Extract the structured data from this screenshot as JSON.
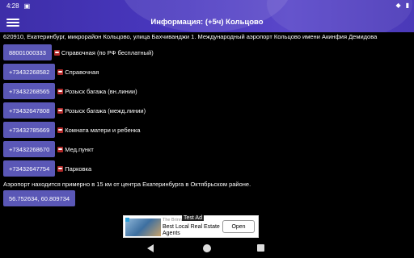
{
  "status": {
    "time": "4:28",
    "notification_icon": "android-alert-icon",
    "wifi_icon": "wifi-icon",
    "battery_icon": "battery-icon"
  },
  "app_bar": {
    "title": "Информация: (+5ч) Кольцово",
    "menu_icon": "hamburger-menu-icon"
  },
  "address": "620910, Екатеринбург, микрорайон Кольцово, улица Бахчиванджи 1. Международный аэропорт Кольцово имени Акинфия Демидова",
  "contacts": [
    {
      "phone": "88001000333",
      "label": "Справочная (по РФ бесплатный)"
    },
    {
      "phone": "+73432268582",
      "label": "Справочная"
    },
    {
      "phone": "+73432268565",
      "label": "Розыск багажа (вн.линии)"
    },
    {
      "phone": "+73432647808",
      "label": "Розыск багажа (межд.линии)"
    },
    {
      "phone": "+73432785669",
      "label": "Комната матери и ребенка"
    },
    {
      "phone": "+73432268670",
      "label": "Мед.пункт"
    },
    {
      "phone": "+73432647754",
      "label": "Парковка"
    }
  ],
  "location_info": "Аэропорт находится примерно в 15 км от центра Екатеринбурга в Октябрьском районе.",
  "coordinates": "56.752634, 60.809734",
  "ad": {
    "tag": "Test Ad",
    "brand": "The Brinn",
    "headline": "Best Local Real Estate Agents",
    "button": "Open"
  },
  "colors": {
    "app_bar": "#4a38c0",
    "button": "#5a57b6",
    "background": "#000000",
    "phone_icon": "#b12a2a"
  }
}
